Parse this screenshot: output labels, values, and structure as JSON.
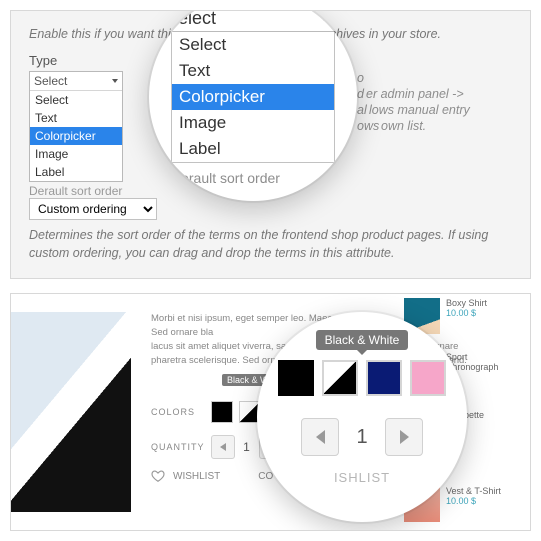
{
  "panel1": {
    "enable_hint": "Enable this if you want this attribute to have product archives in your store.",
    "type_label": "Type",
    "type_value": "Select",
    "type_options": [
      "Select",
      "Text",
      "Colorpicker",
      "Image",
      "Label"
    ],
    "sort_label_trunc": "Derault sort order",
    "sort_value": "Custom ordering",
    "sort_hint": "Determines the sort order of the terms on the frontend shop product pages. If using custom ordering, you can drag and drop the terms in this attribute.",
    "behind_frag1": "o",
    "behind_frag2": "d",
    "behind_frag_admin": "er admin panel ->",
    "behind_frag3": "al",
    "behind_frag_manual": "lows manual entry",
    "behind_frag4": "ows",
    "behind_frag_list": "own list.",
    "zoom_top_trunc": "elect",
    "zoom_options": [
      "Select",
      "Text",
      "Colorpicker",
      "Image",
      "Label"
    ],
    "zoom_below": "Derault sort order"
  },
  "panel2": {
    "desc_l1": "Morbi et nisi ipsum, eget semper leo. Maecenas congue. Sed ornare bla",
    "desc_l2": "lacus sit amet aliquet viverra, sapien felis tincidunt du",
    "desc_l3": "pharetra scelerisque. Sed ornare blandit volutpat.",
    "desc_trail": "ornare eleifend.",
    "colors_label": "COLORS",
    "qty_label": "QUANTITY",
    "qty_value": "1",
    "wishlist_label": "WISHLIST",
    "compare_trunc": "CO",
    "tooltip_small": "Black & White",
    "side1_title": "Boxy Shirt",
    "side1_price": "10.00 $",
    "side2_title": "Sport Chronograph",
    "side3_title": "Salopette",
    "side4_title": "Vest & T-Shirt",
    "side4_price": "10.00 $",
    "zoom": {
      "tooltip": "Black & White",
      "qty_value": "1",
      "below_trunc": "ISHLIST"
    }
  }
}
